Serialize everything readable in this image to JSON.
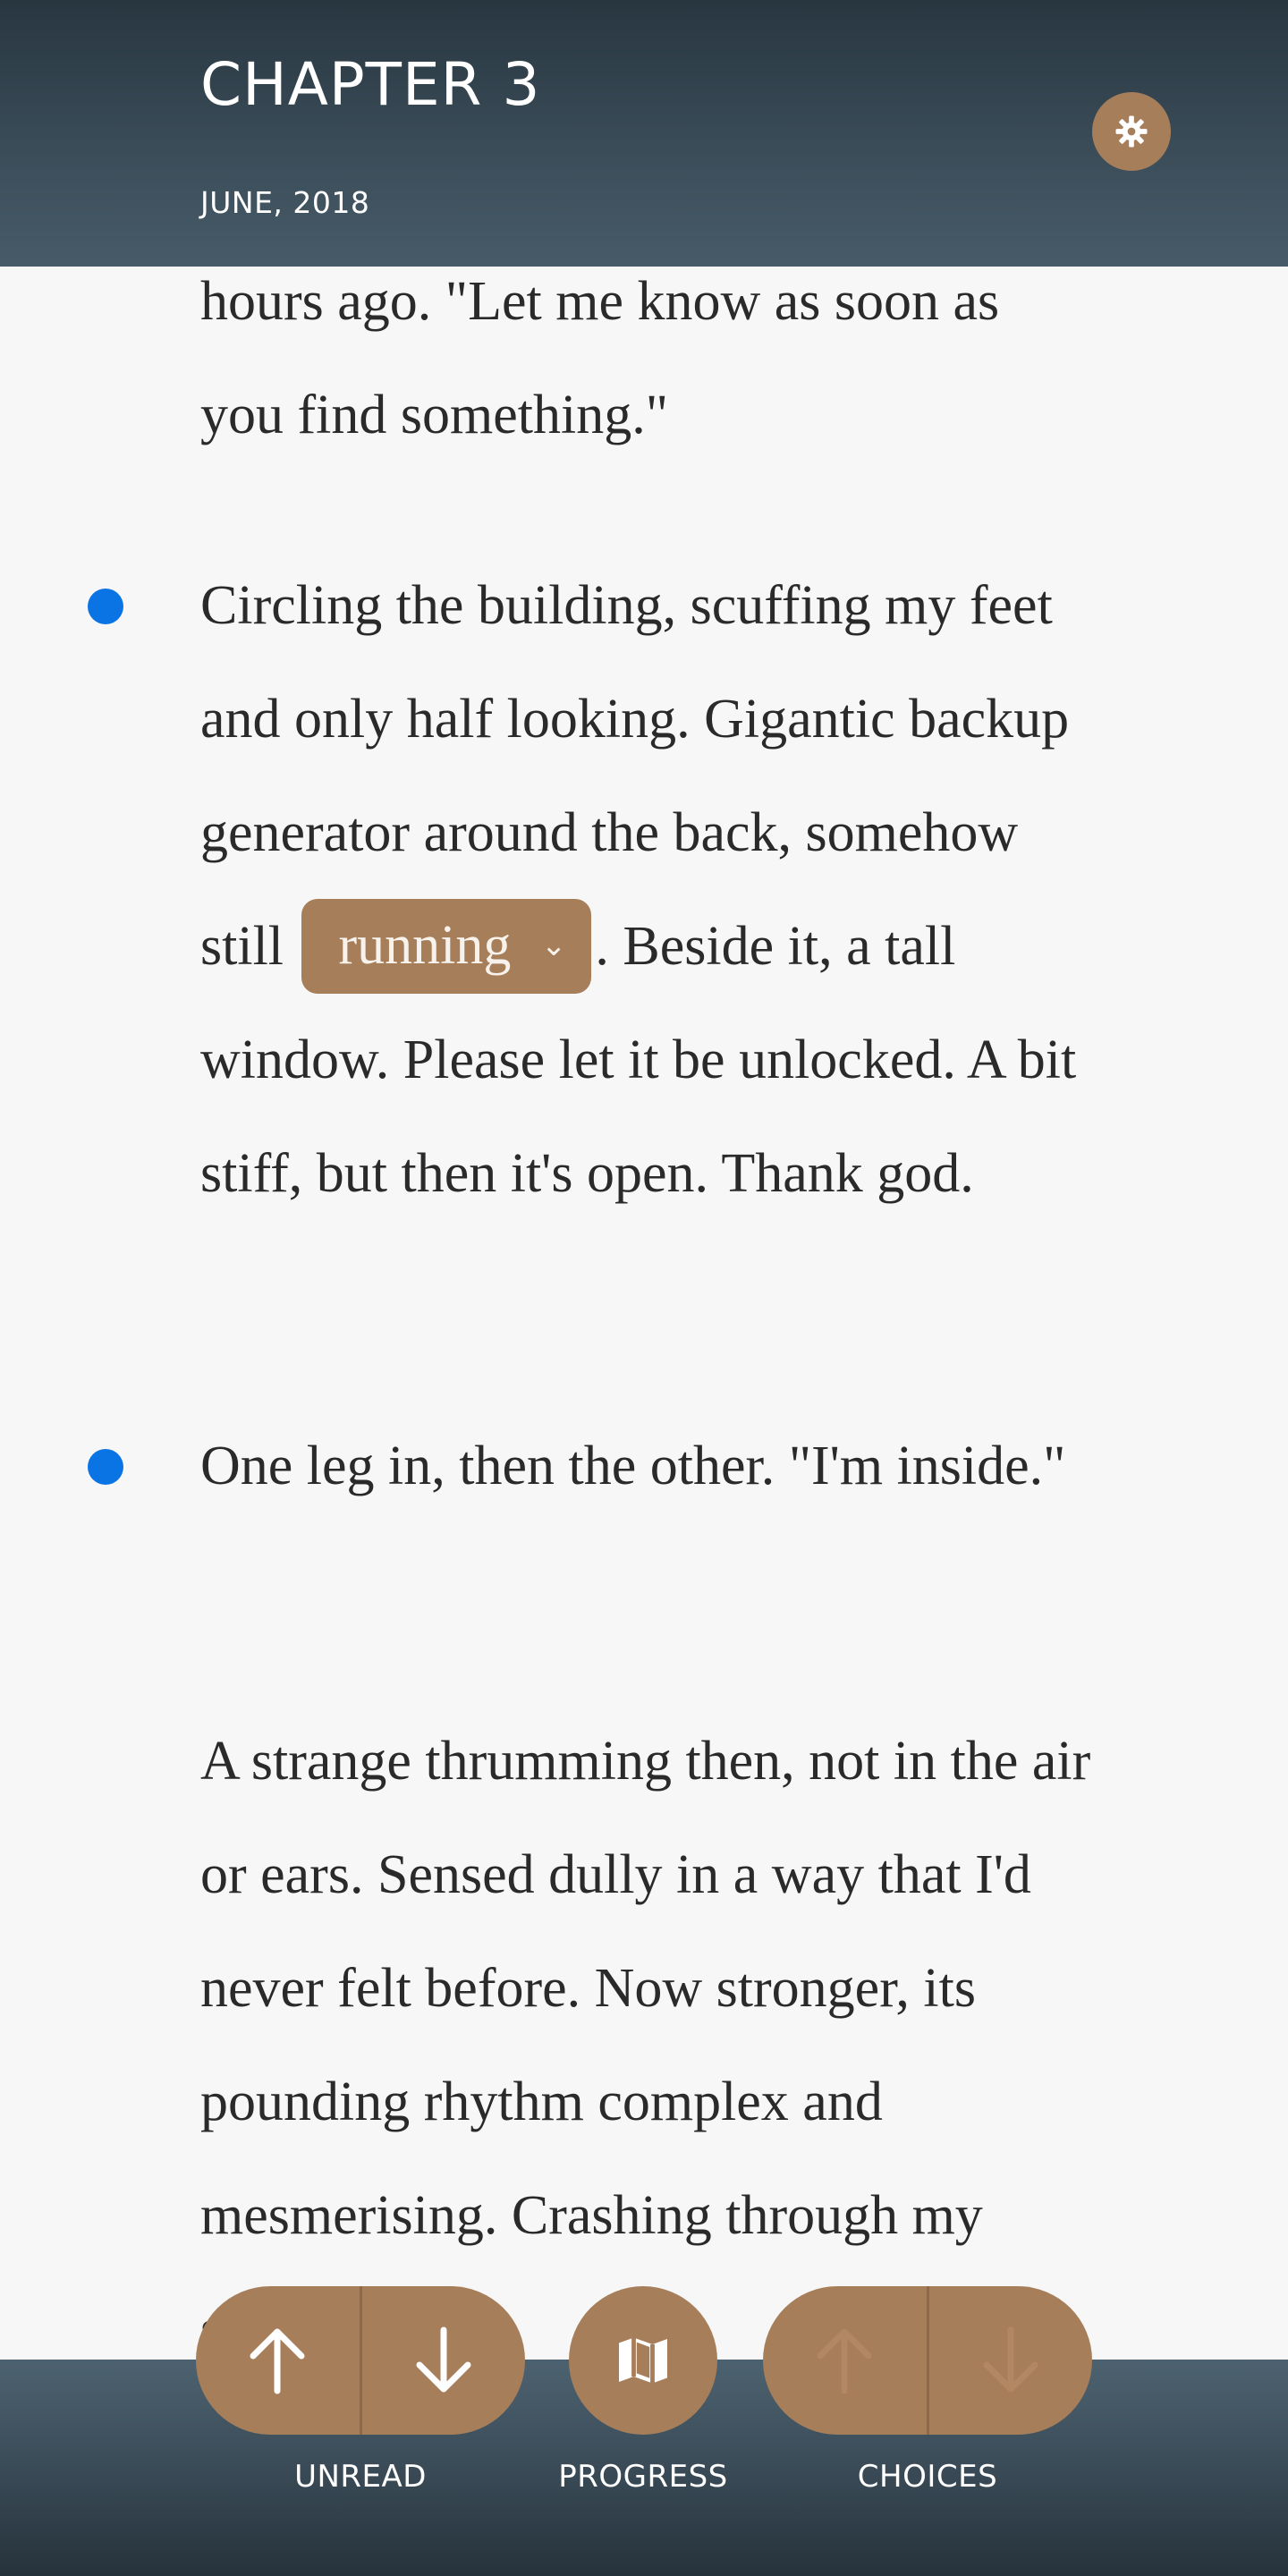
{
  "header": {
    "title": "CHAPTER 3",
    "date": "JUNE, 2018",
    "settings_icon": "gear-icon"
  },
  "story": {
    "paragraphs": [
      {
        "text": "hours ago. \"Let me know as soon as you find something.\"",
        "unread": false
      },
      {
        "text_before": "Circling the building, scuffing my feet and only half looking. Gigantic backup generator around the back, somehow still",
        "choice": "running",
        "text_after": ". Beside it, a tall window. Please let it be unlocked. A bit stiff, but then it's open. Thank god.",
        "unread": true
      },
      {
        "text": "One leg in, then the other. \"I'm inside.\"",
        "unread": true
      },
      {
        "text": "A strange thrumming then, not in the air or ears. Sensed dully in a way that I'd never felt before. Now stronger, its pounding rhythm complex and mesmerising. Crashing through my sudden",
        "unread": false
      }
    ]
  },
  "footer": {
    "unread_label": "UNREAD",
    "progress_label": "PROGRESS",
    "choices_label": "CHOICES",
    "accent_color": "#a77e5a",
    "unread_up_icon": "arrow-up-icon",
    "unread_down_icon": "arrow-down-icon",
    "progress_icon": "map-icon",
    "choices_up_icon": "arrow-up-icon",
    "choices_down_icon": "arrow-down-icon"
  },
  "colors": {
    "header": "#36454f",
    "marker": "#0b74e5",
    "accent": "#a77e5a",
    "text": "#2a2a2a",
    "background": "#f7f7f7"
  }
}
